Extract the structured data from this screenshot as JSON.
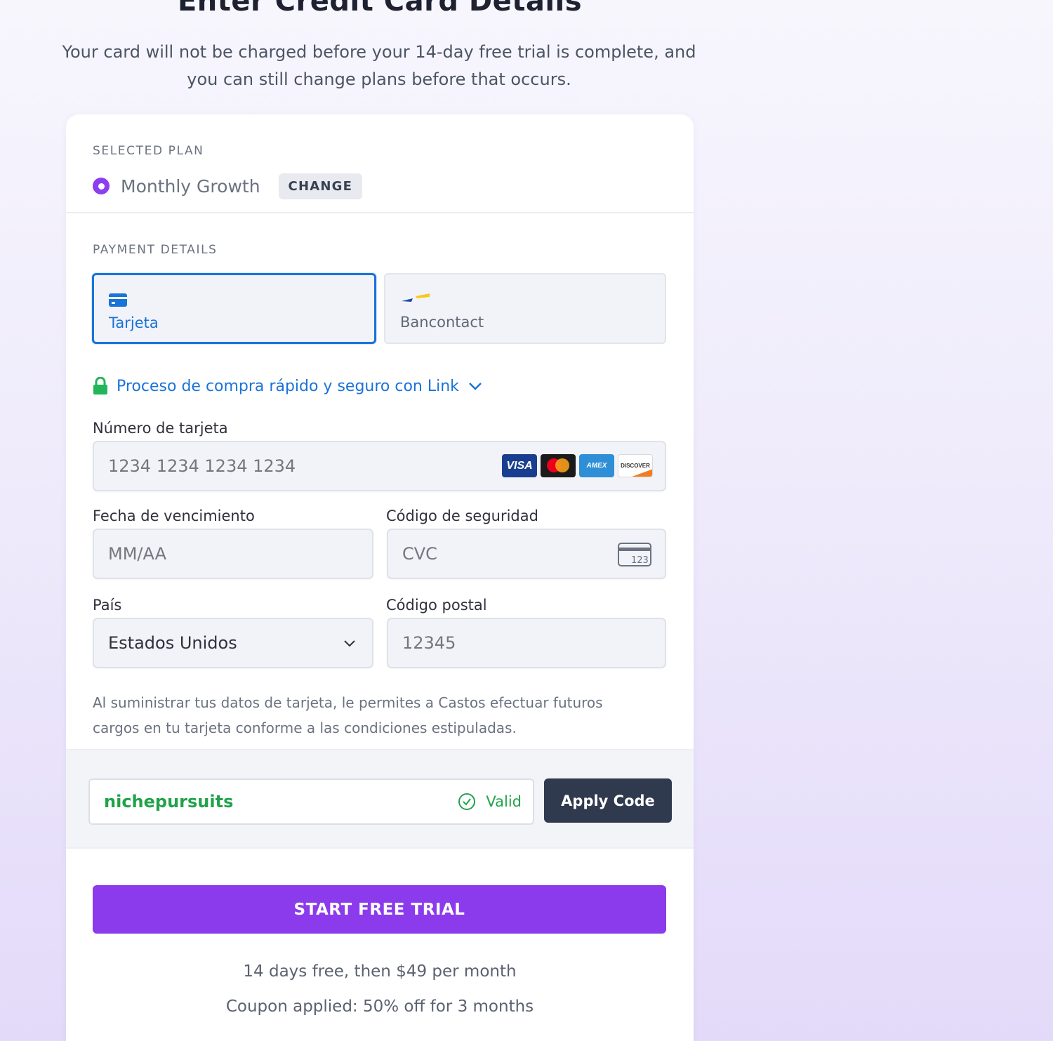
{
  "header": {
    "title": "Enter Credit Card Details",
    "subtitle_line1": "Your card will not be charged before your 14-day free trial is complete, and",
    "subtitle_line2": "you can still change plans before that occurs."
  },
  "plan": {
    "section_label": "SELECTED PLAN",
    "name": "Monthly Growth",
    "change_label": "CHANGE"
  },
  "payment": {
    "section_label": "PAYMENT DETAILS",
    "methods": [
      {
        "label": "Tarjeta",
        "icon": "credit-card-icon",
        "selected": true
      },
      {
        "label": "Bancontact",
        "icon": "bancontact-icon",
        "selected": false
      }
    ],
    "link_text": "Proceso de compra rápido y seguro con Link",
    "card_number": {
      "label": "Número de tarjeta",
      "placeholder": "1234 1234 1234 1234"
    },
    "card_brands": [
      "VISA",
      "Mastercard",
      "AMEX",
      "DISCOVER"
    ],
    "expiry": {
      "label": "Fecha de vencimiento",
      "placeholder": "MM/AA"
    },
    "cvc": {
      "label": "Código de seguridad",
      "placeholder": "CVC",
      "icon_text": "123"
    },
    "country": {
      "label": "País",
      "value": "Estados Unidos"
    },
    "postal": {
      "label": "Código postal",
      "placeholder": "12345"
    },
    "legal_line1": "Al suministrar tus datos de tarjeta, le permites a Castos efectuar futuros",
    "legal_line2": "cargos en tu tarjeta conforme a las condiciones estipuladas."
  },
  "coupon": {
    "code": "nichepursuits",
    "status": "Valid",
    "apply_label": "Apply Code"
  },
  "cta": {
    "label": "START FREE TRIAL",
    "note_price": "14 days free, then $49 per month",
    "note_coupon": "Coupon applied: 50% off for 3 months"
  },
  "colors": {
    "accent": "#8b3aec",
    "link": "#1a73d9",
    "valid": "#22a24a"
  }
}
